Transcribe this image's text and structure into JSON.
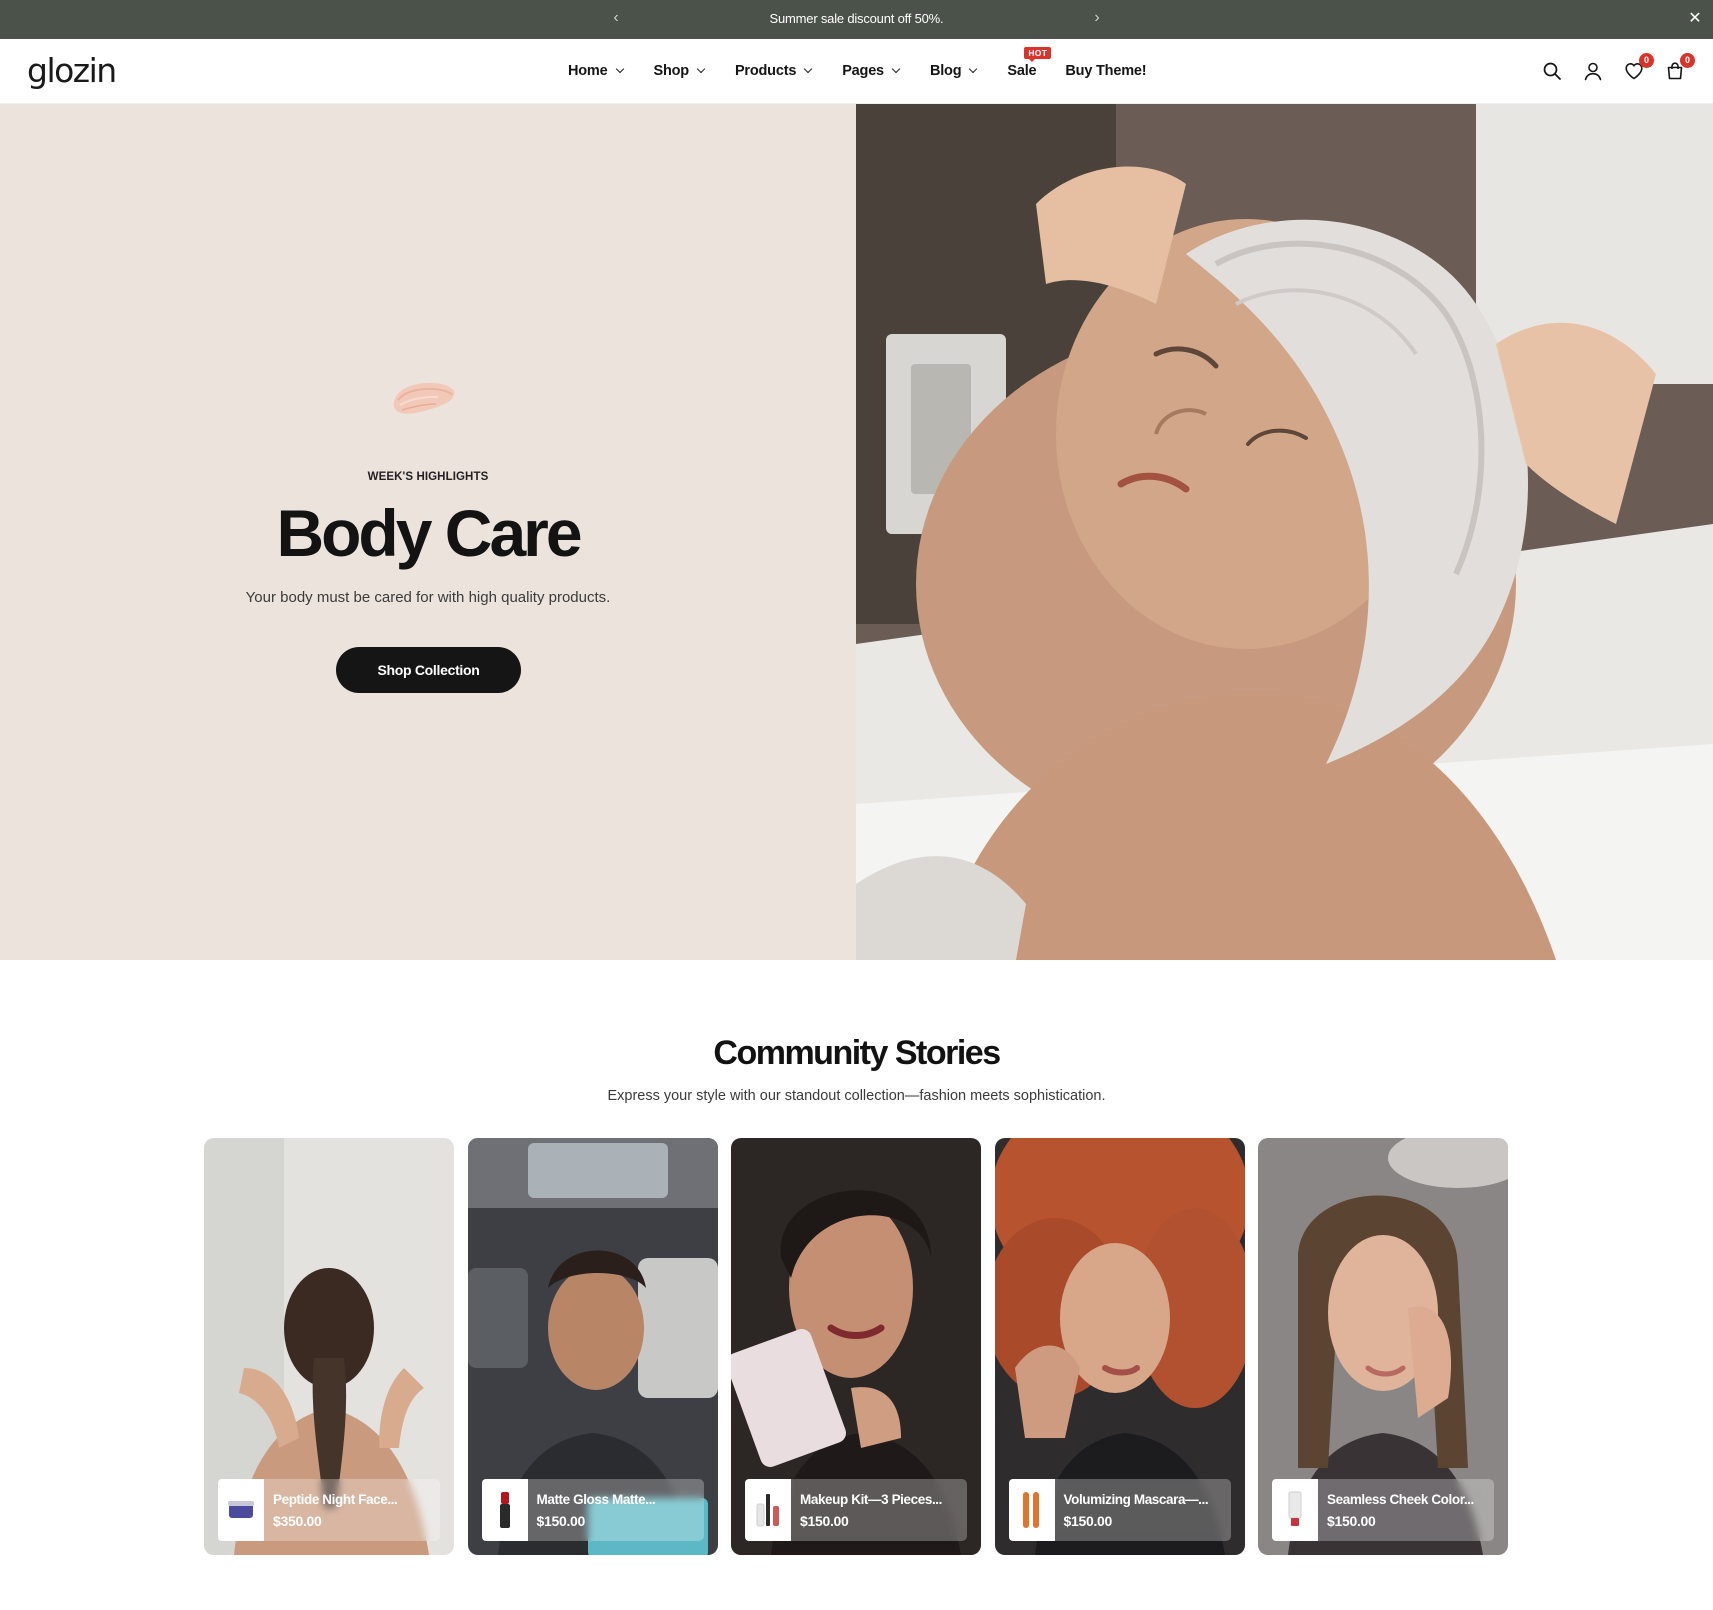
{
  "announcement": {
    "message": "Summer sale discount off 50%.",
    "prev_icon": "chevron-left-icon",
    "next_icon": "chevron-right-icon",
    "close_icon": "close-icon"
  },
  "header": {
    "logo": "glozin",
    "nav": [
      {
        "label": "Home",
        "has_dropdown": true
      },
      {
        "label": "Shop",
        "has_dropdown": true
      },
      {
        "label": "Products",
        "has_dropdown": true
      },
      {
        "label": "Pages",
        "has_dropdown": true
      },
      {
        "label": "Blog",
        "has_dropdown": true
      },
      {
        "label": "Sale",
        "has_dropdown": false,
        "badge": "HOT"
      },
      {
        "label": "Buy Theme!",
        "has_dropdown": false
      }
    ],
    "wishlist_count": "0",
    "cart_count": "0"
  },
  "hero": {
    "eyebrow": "WEEK'S HIGHLIGHTS",
    "title": "Body Care",
    "subtitle": "Your body must be cared for with high quality products.",
    "cta": "Shop Collection"
  },
  "community": {
    "title": "Community Stories",
    "subtitle": "Express your style with our standout collection—fashion meets sophistication.",
    "stories": [
      {
        "product": "Peptide Night Face...",
        "price": "$350.00"
      },
      {
        "product": "Matte Gloss Matte...",
        "price": "$150.00"
      },
      {
        "product": "Makeup Kit—3 Pieces...",
        "price": "$150.00"
      },
      {
        "product": "Volumizing Mascara—...",
        "price": "$150.00"
      },
      {
        "product": "Seamless Cheek Color...",
        "price": "$150.00"
      }
    ]
  },
  "colors": {
    "announcement_bg": "#4a5249",
    "hero_left_bg": "#ebe3dc",
    "badge_red": "#d9342b",
    "button_dark": "#151515"
  }
}
